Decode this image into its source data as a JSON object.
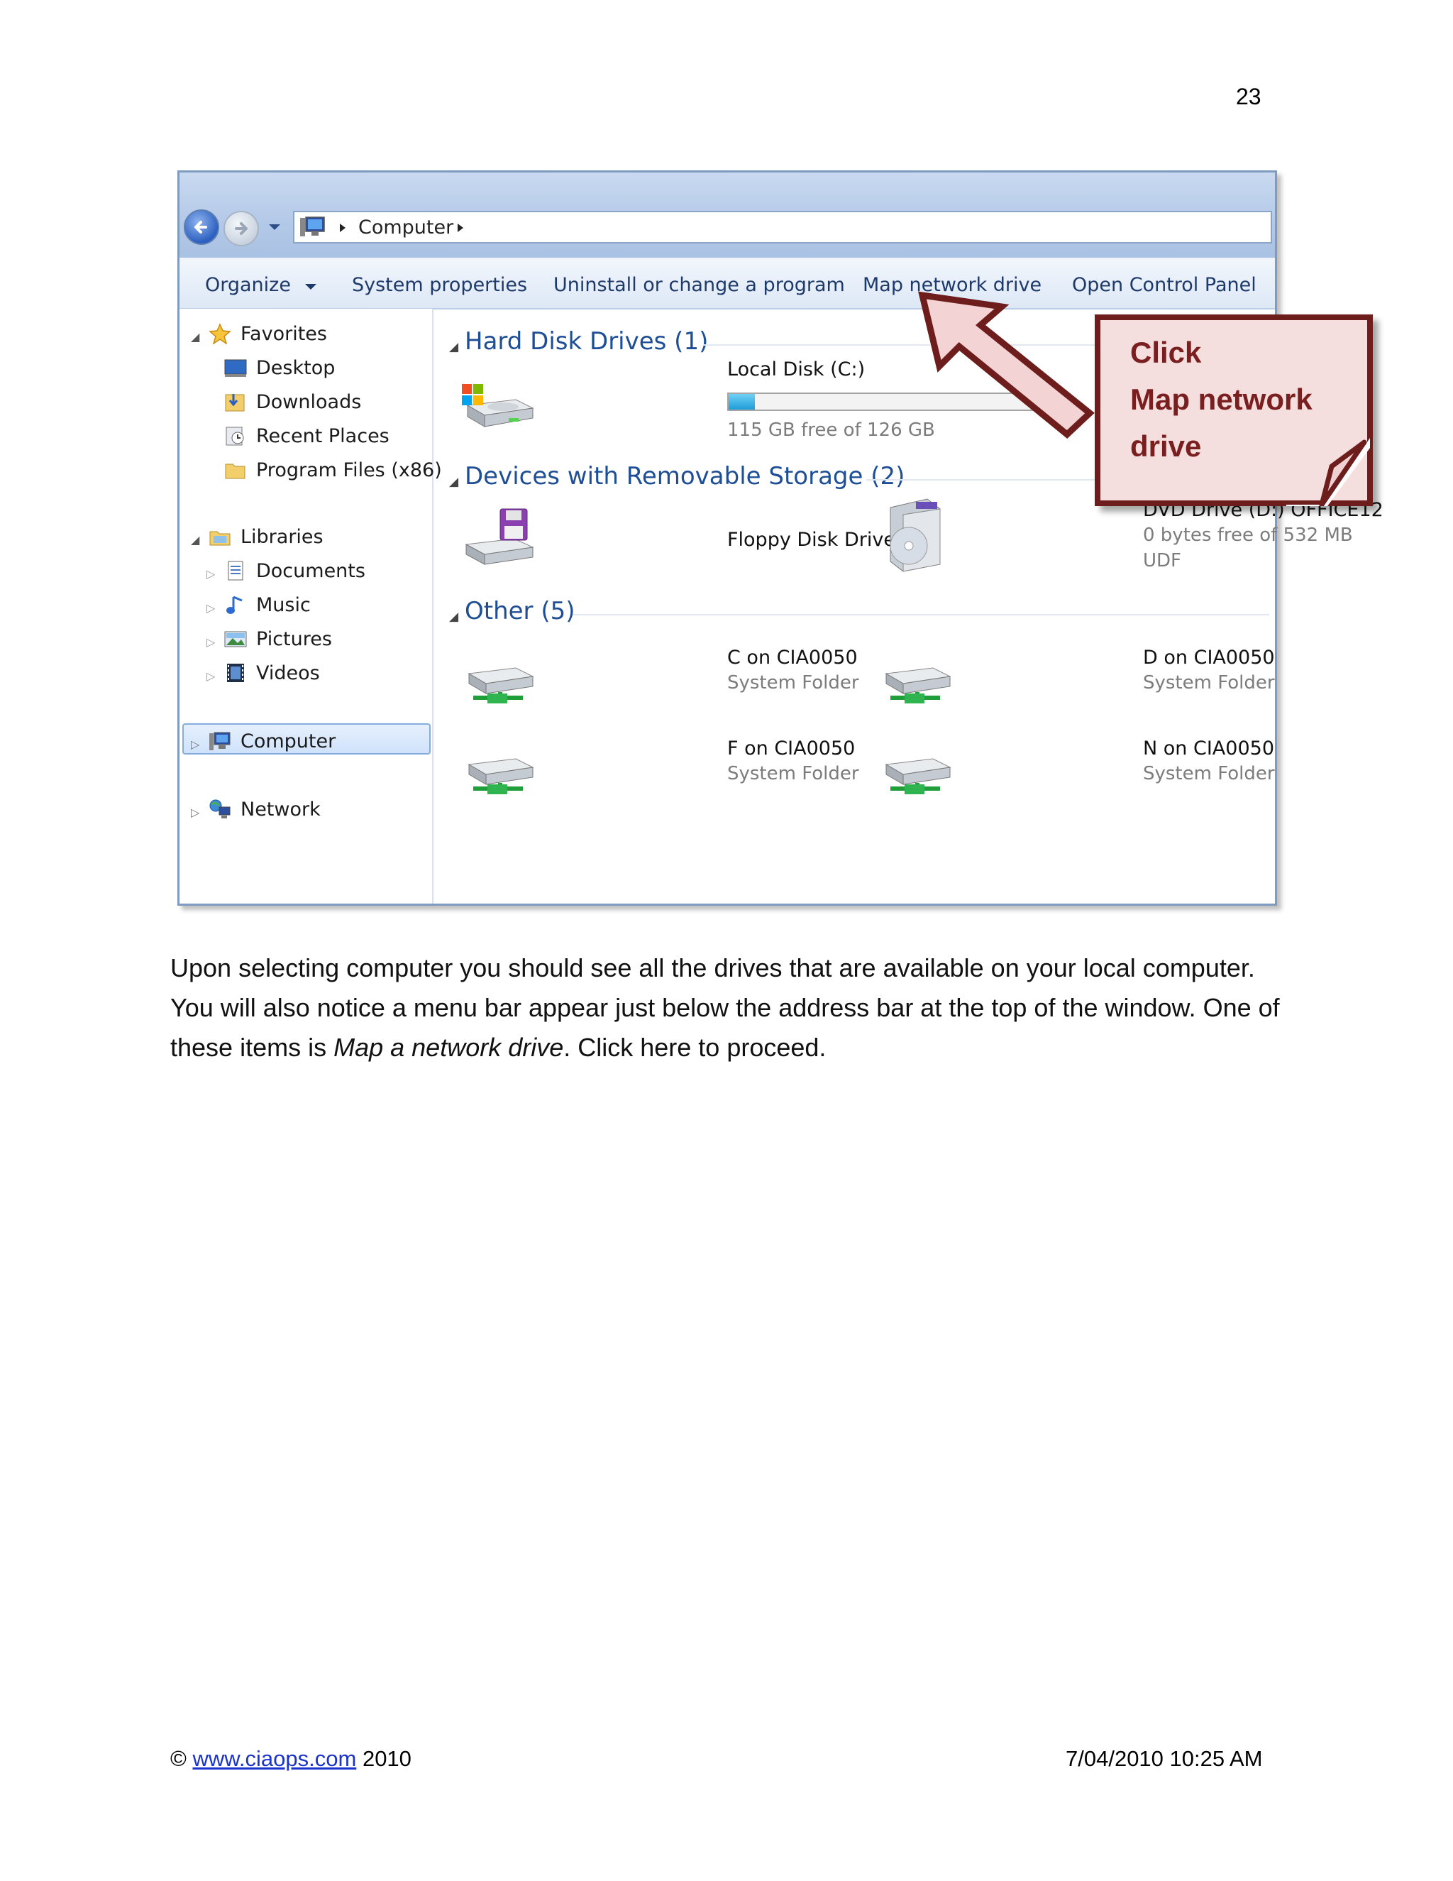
{
  "page_number": "23",
  "window": {
    "address": {
      "location": "Computer"
    },
    "toolbar": {
      "organize": "Organize",
      "system_properties": "System properties",
      "uninstall": "Uninstall or change a program",
      "map_network_drive": "Map network drive",
      "open_control_panel": "Open Control Panel"
    },
    "nav": {
      "favorites": "Favorites",
      "favorites_items": [
        "Desktop",
        "Downloads",
        "Recent Places",
        "Program Files (x86)"
      ],
      "libraries": "Libraries",
      "libraries_items": [
        "Documents",
        "Music",
        "Pictures",
        "Videos"
      ],
      "computer": "Computer",
      "network": "Network"
    },
    "groups": {
      "hard_disk": "Hard Disk Drives (1)",
      "removable": "Devices with Removable Storage (2)",
      "other": "Other (5)"
    },
    "hard_disk_items": [
      {
        "name": "Local Disk (C:)",
        "detail": "115 GB free of 126 GB",
        "used_fraction": 0.087
      }
    ],
    "removable_items": [
      {
        "name": "Floppy Disk Drive (A:)"
      },
      {
        "name": "DVD Drive (D:) OFFICE12",
        "detail": "0 bytes free of 532 MB",
        "filesystem": "UDF"
      }
    ],
    "other_items": [
      {
        "name": "C on CIA0050",
        "detail": "System Folder"
      },
      {
        "name": "D on CIA0050",
        "detail": "System Folder"
      },
      {
        "name": "F on CIA0050",
        "detail": "System Folder"
      },
      {
        "name": "N on CIA0050",
        "detail": "System Folder"
      }
    ]
  },
  "callout": {
    "line1": "Click",
    "line2": "Map network",
    "line3": "drive"
  },
  "body": {
    "text1": "Upon selecting computer you should see all the drives that are available on your local computer. You will also notice a menu bar appear just below the address bar at the top of the window. One of these items is ",
    "emphasis": "Map a network drive",
    "text2": ". Click here to proceed."
  },
  "footer": {
    "copyright": "©",
    "link": "www.ciaops.com",
    "year": "2010",
    "datetime": "7/04/2010 10:25 AM"
  },
  "colors": {
    "callout_border": "#6e1d1d",
    "callout_fill": "#f5dede",
    "link": "#1a33cc",
    "group_header": "#1e4e96"
  }
}
